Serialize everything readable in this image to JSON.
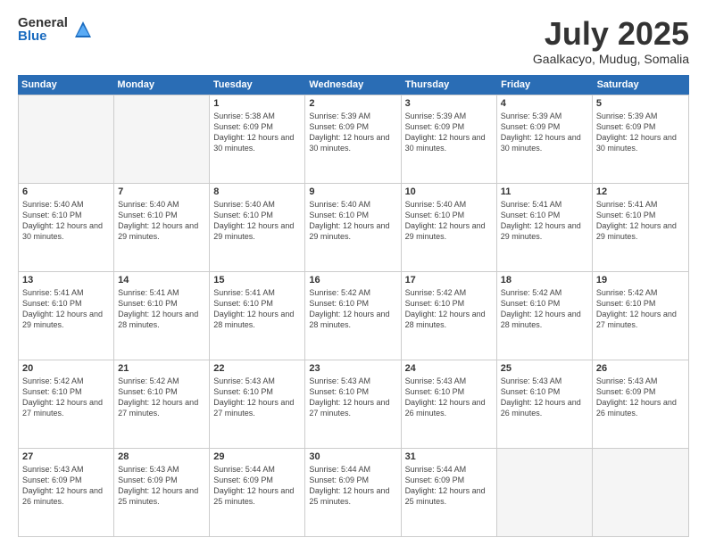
{
  "logo": {
    "general": "General",
    "blue": "Blue"
  },
  "title": {
    "month_year": "July 2025",
    "location": "Gaalkacyo, Mudug, Somalia"
  },
  "weekdays": [
    "Sunday",
    "Monday",
    "Tuesday",
    "Wednesday",
    "Thursday",
    "Friday",
    "Saturday"
  ],
  "weeks": [
    [
      {
        "day": "",
        "sunrise": "",
        "sunset": "",
        "daylight": "",
        "empty": true
      },
      {
        "day": "",
        "sunrise": "",
        "sunset": "",
        "daylight": "",
        "empty": true
      },
      {
        "day": "1",
        "sunrise": "Sunrise: 5:38 AM",
        "sunset": "Sunset: 6:09 PM",
        "daylight": "Daylight: 12 hours and 30 minutes.",
        "empty": false
      },
      {
        "day": "2",
        "sunrise": "Sunrise: 5:39 AM",
        "sunset": "Sunset: 6:09 PM",
        "daylight": "Daylight: 12 hours and 30 minutes.",
        "empty": false
      },
      {
        "day": "3",
        "sunrise": "Sunrise: 5:39 AM",
        "sunset": "Sunset: 6:09 PM",
        "daylight": "Daylight: 12 hours and 30 minutes.",
        "empty": false
      },
      {
        "day": "4",
        "sunrise": "Sunrise: 5:39 AM",
        "sunset": "Sunset: 6:09 PM",
        "daylight": "Daylight: 12 hours and 30 minutes.",
        "empty": false
      },
      {
        "day": "5",
        "sunrise": "Sunrise: 5:39 AM",
        "sunset": "Sunset: 6:09 PM",
        "daylight": "Daylight: 12 hours and 30 minutes.",
        "empty": false
      }
    ],
    [
      {
        "day": "6",
        "sunrise": "Sunrise: 5:40 AM",
        "sunset": "Sunset: 6:10 PM",
        "daylight": "Daylight: 12 hours and 30 minutes.",
        "empty": false
      },
      {
        "day": "7",
        "sunrise": "Sunrise: 5:40 AM",
        "sunset": "Sunset: 6:10 PM",
        "daylight": "Daylight: 12 hours and 29 minutes.",
        "empty": false
      },
      {
        "day": "8",
        "sunrise": "Sunrise: 5:40 AM",
        "sunset": "Sunset: 6:10 PM",
        "daylight": "Daylight: 12 hours and 29 minutes.",
        "empty": false
      },
      {
        "day": "9",
        "sunrise": "Sunrise: 5:40 AM",
        "sunset": "Sunset: 6:10 PM",
        "daylight": "Daylight: 12 hours and 29 minutes.",
        "empty": false
      },
      {
        "day": "10",
        "sunrise": "Sunrise: 5:40 AM",
        "sunset": "Sunset: 6:10 PM",
        "daylight": "Daylight: 12 hours and 29 minutes.",
        "empty": false
      },
      {
        "day": "11",
        "sunrise": "Sunrise: 5:41 AM",
        "sunset": "Sunset: 6:10 PM",
        "daylight": "Daylight: 12 hours and 29 minutes.",
        "empty": false
      },
      {
        "day": "12",
        "sunrise": "Sunrise: 5:41 AM",
        "sunset": "Sunset: 6:10 PM",
        "daylight": "Daylight: 12 hours and 29 minutes.",
        "empty": false
      }
    ],
    [
      {
        "day": "13",
        "sunrise": "Sunrise: 5:41 AM",
        "sunset": "Sunset: 6:10 PM",
        "daylight": "Daylight: 12 hours and 29 minutes.",
        "empty": false
      },
      {
        "day": "14",
        "sunrise": "Sunrise: 5:41 AM",
        "sunset": "Sunset: 6:10 PM",
        "daylight": "Daylight: 12 hours and 28 minutes.",
        "empty": false
      },
      {
        "day": "15",
        "sunrise": "Sunrise: 5:41 AM",
        "sunset": "Sunset: 6:10 PM",
        "daylight": "Daylight: 12 hours and 28 minutes.",
        "empty": false
      },
      {
        "day": "16",
        "sunrise": "Sunrise: 5:42 AM",
        "sunset": "Sunset: 6:10 PM",
        "daylight": "Daylight: 12 hours and 28 minutes.",
        "empty": false
      },
      {
        "day": "17",
        "sunrise": "Sunrise: 5:42 AM",
        "sunset": "Sunset: 6:10 PM",
        "daylight": "Daylight: 12 hours and 28 minutes.",
        "empty": false
      },
      {
        "day": "18",
        "sunrise": "Sunrise: 5:42 AM",
        "sunset": "Sunset: 6:10 PM",
        "daylight": "Daylight: 12 hours and 28 minutes.",
        "empty": false
      },
      {
        "day": "19",
        "sunrise": "Sunrise: 5:42 AM",
        "sunset": "Sunset: 6:10 PM",
        "daylight": "Daylight: 12 hours and 27 minutes.",
        "empty": false
      }
    ],
    [
      {
        "day": "20",
        "sunrise": "Sunrise: 5:42 AM",
        "sunset": "Sunset: 6:10 PM",
        "daylight": "Daylight: 12 hours and 27 minutes.",
        "empty": false
      },
      {
        "day": "21",
        "sunrise": "Sunrise: 5:42 AM",
        "sunset": "Sunset: 6:10 PM",
        "daylight": "Daylight: 12 hours and 27 minutes.",
        "empty": false
      },
      {
        "day": "22",
        "sunrise": "Sunrise: 5:43 AM",
        "sunset": "Sunset: 6:10 PM",
        "daylight": "Daylight: 12 hours and 27 minutes.",
        "empty": false
      },
      {
        "day": "23",
        "sunrise": "Sunrise: 5:43 AM",
        "sunset": "Sunset: 6:10 PM",
        "daylight": "Daylight: 12 hours and 27 minutes.",
        "empty": false
      },
      {
        "day": "24",
        "sunrise": "Sunrise: 5:43 AM",
        "sunset": "Sunset: 6:10 PM",
        "daylight": "Daylight: 12 hours and 26 minutes.",
        "empty": false
      },
      {
        "day": "25",
        "sunrise": "Sunrise: 5:43 AM",
        "sunset": "Sunset: 6:10 PM",
        "daylight": "Daylight: 12 hours and 26 minutes.",
        "empty": false
      },
      {
        "day": "26",
        "sunrise": "Sunrise: 5:43 AM",
        "sunset": "Sunset: 6:09 PM",
        "daylight": "Daylight: 12 hours and 26 minutes.",
        "empty": false
      }
    ],
    [
      {
        "day": "27",
        "sunrise": "Sunrise: 5:43 AM",
        "sunset": "Sunset: 6:09 PM",
        "daylight": "Daylight: 12 hours and 26 minutes.",
        "empty": false
      },
      {
        "day": "28",
        "sunrise": "Sunrise: 5:43 AM",
        "sunset": "Sunset: 6:09 PM",
        "daylight": "Daylight: 12 hours and 25 minutes.",
        "empty": false
      },
      {
        "day": "29",
        "sunrise": "Sunrise: 5:44 AM",
        "sunset": "Sunset: 6:09 PM",
        "daylight": "Daylight: 12 hours and 25 minutes.",
        "empty": false
      },
      {
        "day": "30",
        "sunrise": "Sunrise: 5:44 AM",
        "sunset": "Sunset: 6:09 PM",
        "daylight": "Daylight: 12 hours and 25 minutes.",
        "empty": false
      },
      {
        "day": "31",
        "sunrise": "Sunrise: 5:44 AM",
        "sunset": "Sunset: 6:09 PM",
        "daylight": "Daylight: 12 hours and 25 minutes.",
        "empty": false
      },
      {
        "day": "",
        "sunrise": "",
        "sunset": "",
        "daylight": "",
        "empty": true
      },
      {
        "day": "",
        "sunrise": "",
        "sunset": "",
        "daylight": "",
        "empty": true
      }
    ]
  ]
}
